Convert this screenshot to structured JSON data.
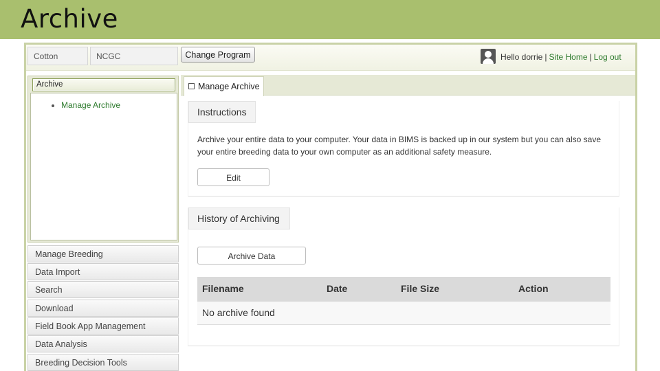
{
  "slide": {
    "title": "Archive"
  },
  "topbar": {
    "crop": "Cotton",
    "program": "NCGC",
    "change_program_label": "Change Program",
    "greeting": "Hello dorrie",
    "site_home": "Site Home",
    "log_out": "Log out",
    "separator": "|"
  },
  "sidebar": {
    "active_section": "Archive",
    "active_links": [
      "Manage Archive"
    ],
    "items": [
      {
        "label": "Manage Breeding"
      },
      {
        "label": "Data Import"
      },
      {
        "label": "Search"
      },
      {
        "label": "Download"
      },
      {
        "label": "Field Book App Management"
      },
      {
        "label": "Data Analysis"
      },
      {
        "label": "Breeding Decision Tools"
      }
    ]
  },
  "main": {
    "tab_label": "Manage Archive",
    "instructions": {
      "title": "Instructions",
      "text": "Archive your entire data to your computer. Your data in BIMS is backed up in our system but you can also save your entire breeding data to your own computer as an additional safety measure.",
      "edit_label": "Edit"
    },
    "history": {
      "title": "History of Archiving",
      "archive_button": "Archive Data",
      "columns": [
        "Filename",
        "Date",
        "File Size",
        "Action"
      ],
      "empty_message": "No archive found"
    }
  },
  "colors": {
    "slide_band": "#a9bf6e",
    "link_green": "#2d7a2d",
    "panel_tint": "#e6e9d6"
  }
}
